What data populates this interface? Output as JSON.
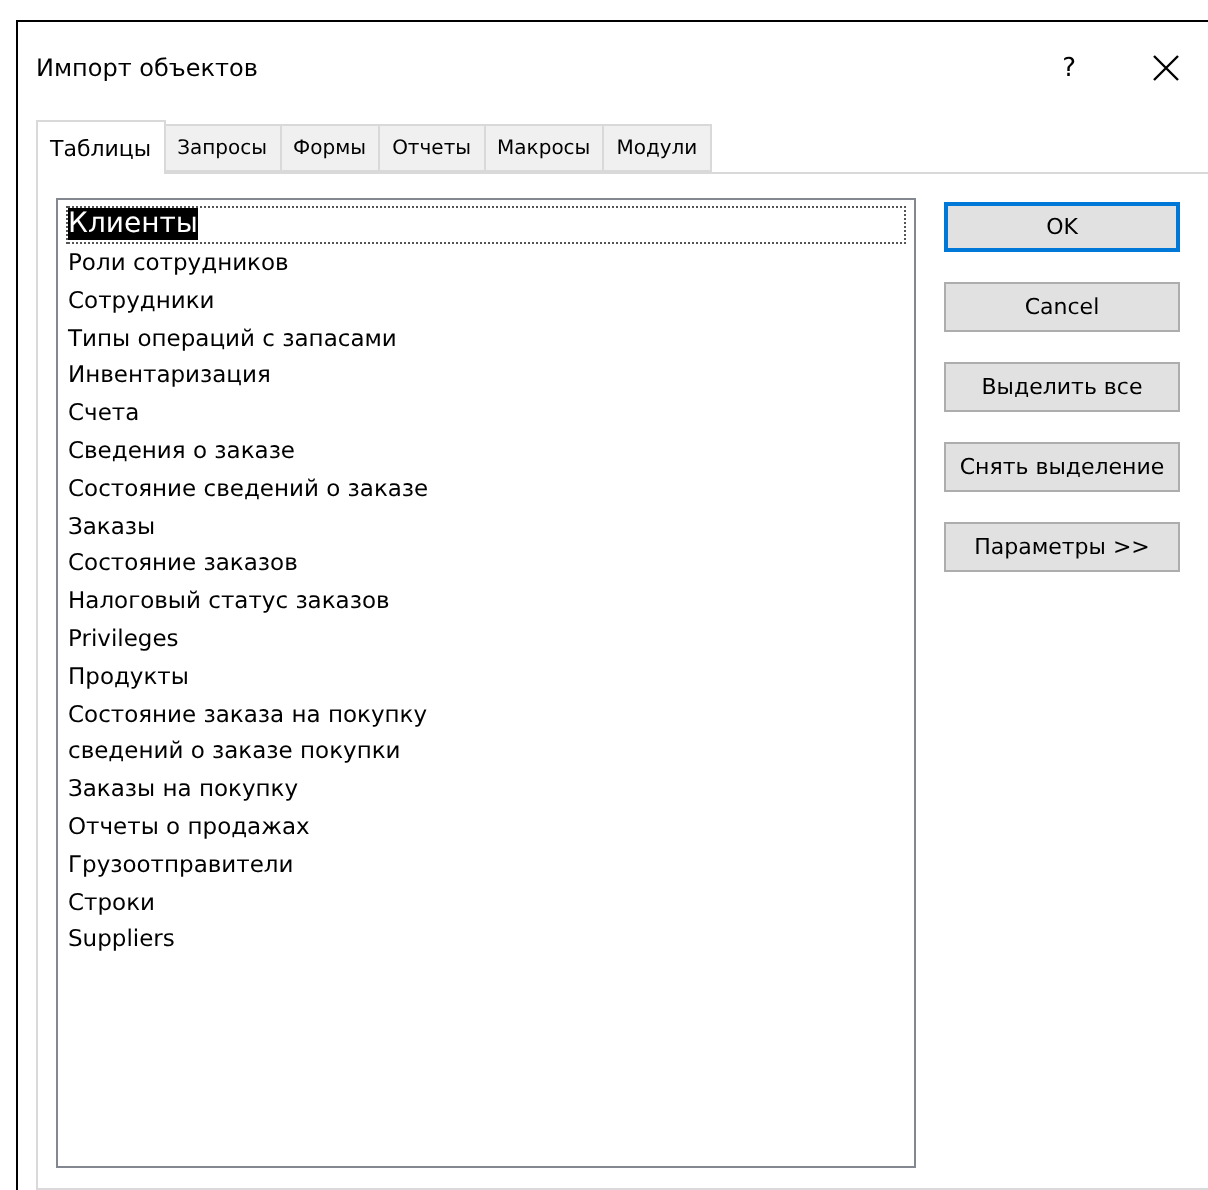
{
  "window": {
    "title": "Импорт объектов",
    "help": "?"
  },
  "tabs": [
    {
      "label": "Таблицы",
      "selected": true
    },
    {
      "label": "Запросы",
      "selected": false
    },
    {
      "label": "Формы",
      "selected": false
    },
    {
      "label": "Отчеты",
      "selected": false
    },
    {
      "label": "Макросы",
      "selected": false
    },
    {
      "label": "Модули",
      "selected": false
    }
  ],
  "list": {
    "items": [
      {
        "label": "Клиенты",
        "selected": true
      },
      {
        "label": "Роли сотрудников",
        "selected": false
      },
      {
        "label": "Сотрудники",
        "selected": false
      },
      {
        "label": "Типы операций с запасами",
        "selected": false
      },
      {
        "label": "Инвентаризация",
        "selected": false
      },
      {
        "label": "Счета",
        "selected": false
      },
      {
        "label": "Сведения о заказе",
        "selected": false
      },
      {
        "label": "Состояние сведений о заказе",
        "selected": false
      },
      {
        "label": "Заказы",
        "selected": false
      },
      {
        "label": "Состояние заказов",
        "selected": false
      },
      {
        "label": "Налоговый статус заказов",
        "selected": false
      },
      {
        "label": "Privileges",
        "selected": false
      },
      {
        "label": "Продукты",
        "selected": false
      },
      {
        "label": "Состояние заказа на покупку",
        "selected": false
      },
      {
        "label": "сведений о заказе покупки",
        "selected": false
      },
      {
        "label": "Заказы на покупку",
        "selected": false
      },
      {
        "label": "Отчеты о продажах",
        "selected": false
      },
      {
        "label": "Грузоотправители",
        "selected": false
      },
      {
        "label": "Строки",
        "selected": false
      },
      {
        "label": "Suppliers",
        "selected": false
      }
    ]
  },
  "buttons": [
    {
      "label": "OK",
      "default": true
    },
    {
      "label": "Cancel",
      "default": false
    },
    {
      "label": "Выделить все",
      "default": false
    },
    {
      "label": "Снять выделение",
      "default": false
    },
    {
      "label": "Параметры >>",
      "default": false
    }
  ]
}
